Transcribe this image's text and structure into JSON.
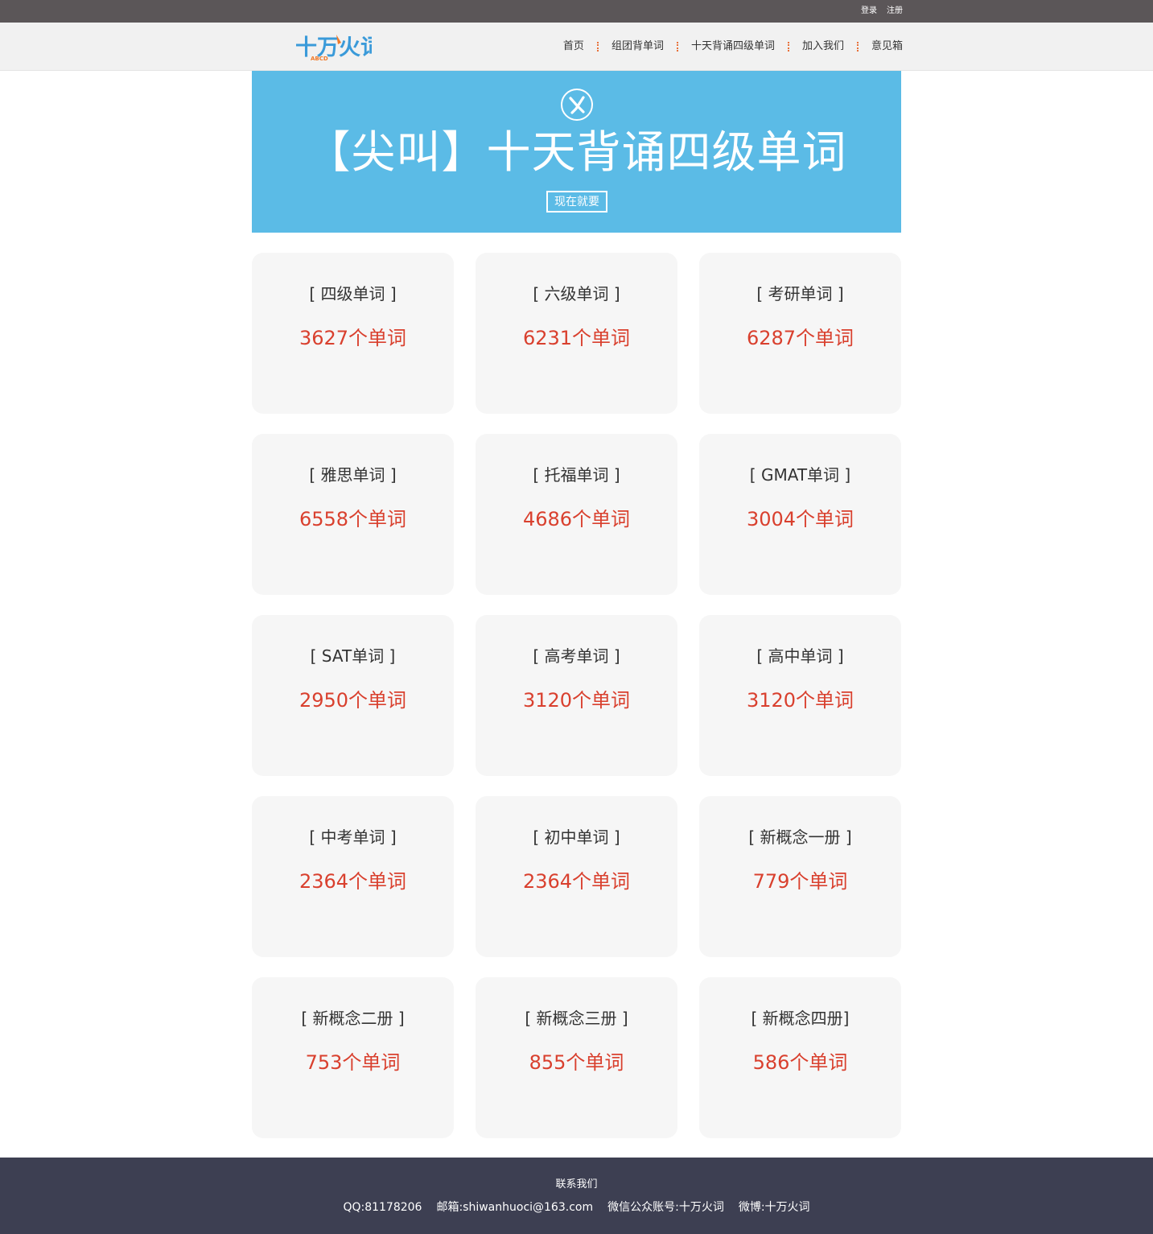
{
  "topbar": {
    "login_label": "登录",
    "register_label": "注册"
  },
  "header": {
    "logo_text": "十万火词",
    "logo_sub": "ABCD",
    "nav": [
      {
        "label": "首页"
      },
      {
        "label": "组团背单词"
      },
      {
        "label": "十天背诵四级单词"
      },
      {
        "label": "加入我们"
      },
      {
        "label": "意见箱"
      }
    ]
  },
  "banner": {
    "title": "【尖叫】十天背诵四级单词",
    "button_label": "现在就要"
  },
  "cards": [
    {
      "name": "[ 四级单词 ]",
      "count": "3627个单词"
    },
    {
      "name": "[ 六级单词 ]",
      "count": "6231个单词"
    },
    {
      "name": "[ 考研单词 ]",
      "count": "6287个单词"
    },
    {
      "name": "[ 雅思单词 ]",
      "count": "6558个单词"
    },
    {
      "name": "[ 托福单词 ]",
      "count": "4686个单词"
    },
    {
      "name": "[ GMAT单词 ]",
      "count": "3004个单词"
    },
    {
      "name": "[ SAT单词 ]",
      "count": "2950个单词"
    },
    {
      "name": "[ 高考单词 ]",
      "count": "3120个单词"
    },
    {
      "name": "[ 高中单词 ]",
      "count": "3120个单词"
    },
    {
      "name": "[ 中考单词 ]",
      "count": "2364个单词"
    },
    {
      "name": "[ 初中单词 ]",
      "count": "2364个单词"
    },
    {
      "name": "[ 新概念一册 ]",
      "count": "779个单词"
    },
    {
      "name": "[ 新概念二册 ]",
      "count": "753个单词"
    },
    {
      "name": "[ 新概念三册 ]",
      "count": "855个单词"
    },
    {
      "name": "[ 新概念四册]",
      "count": "586个单词"
    }
  ],
  "footer": {
    "title": "联系我们",
    "qq": "QQ:81178206",
    "email": "邮箱:shiwanhuoci@163.com",
    "wechat": "微信公众账号:十万火词",
    "weibo": "微博:十万火词"
  },
  "colors": {
    "topbar": "#5b5658",
    "banner": "#5bbbe6",
    "count": "#d9402e",
    "footer": "#3d3f52",
    "nav_separator": "#e8713a"
  },
  "icons": {
    "logo": "shiwanhuoci-logo",
    "banner": "fire-circle-icon"
  }
}
